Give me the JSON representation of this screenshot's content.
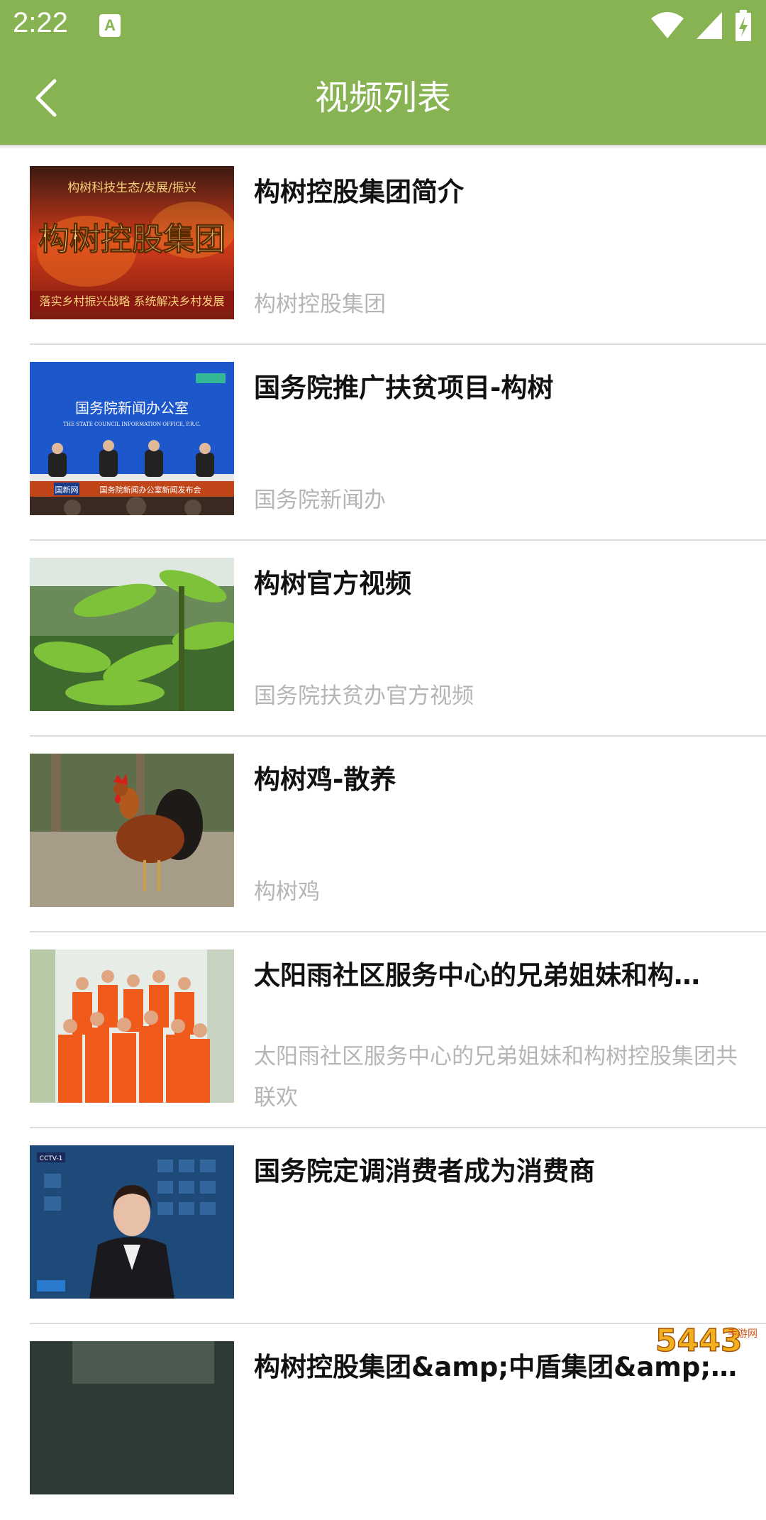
{
  "status_bar": {
    "time": "2:22",
    "notification_icon": "A"
  },
  "app_bar": {
    "title": "视频列表",
    "back_icon": "chevron-left-icon"
  },
  "colors": {
    "accent": "#87b352",
    "title_text": "#111111",
    "sub_text": "#b5b5b5"
  },
  "videos": [
    {
      "title": "构树控股集团简介",
      "subtitle": "构树控股集团",
      "thumb_text_top": "构树科技生态/发展/振兴",
      "thumb_text_main": "构树控股集团",
      "thumb_text_bottom": "落实乡村振兴战略 系统解决乡村发展"
    },
    {
      "title": "国务院推广扶贫项目-构树",
      "subtitle": "国务院新闻办",
      "thumb_text_main": "国务院新闻办公室",
      "thumb_text_en": "THE STATE COUNCIL INFORMATION OFFICE, P.R.C.",
      "thumb_text_bottom": "国务院新闻办公室新闻发布会",
      "thumb_badge": "国新网"
    },
    {
      "title": "构树官方视频",
      "subtitle": "国务院扶贫办官方视频"
    },
    {
      "title": "构树鸡-散养",
      "subtitle": "构树鸡"
    },
    {
      "title": "太阳雨社区服务中心的兄弟姐妹和构…",
      "subtitle": "太阳雨社区服务中心的兄弟姐妹和构树控股集团共联欢"
    },
    {
      "title": "国务院定调消费者成为消费商",
      "subtitle": "",
      "thumb_badge": "CCTV-1"
    },
    {
      "title": "构树控股集团&amp;中盾集团&amp;…",
      "subtitle": ""
    }
  ],
  "watermark": {
    "text": "5443",
    "site": "手游网"
  }
}
